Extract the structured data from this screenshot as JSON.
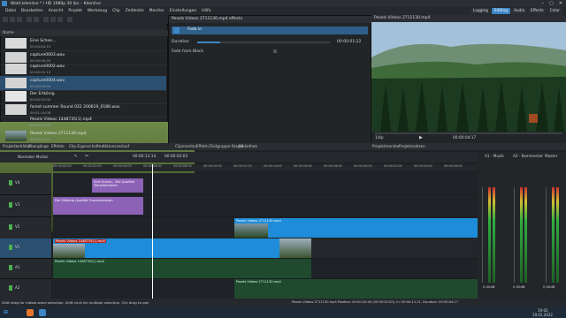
{
  "window": {
    "title": "Wald.kdenlive * / HD 1080p 30 fps – Kdenlive",
    "controls": [
      "–",
      "▢",
      "✕"
    ]
  },
  "menu": [
    "Datei",
    "Bearbeiten",
    "Ansicht",
    "Projekt",
    "Werkzeug",
    "Clip",
    "Zeitleiste",
    "Monitor",
    "Einstellungen",
    "Hilfe"
  ],
  "workspaces": [
    "Logging",
    "Editing",
    "Audio",
    "Effects",
    "Color"
  ],
  "workspace_active": "Editing",
  "bin": {
    "header": "Name",
    "items": [
      {
        "name": "Eine Schee...",
        "duration": "00:00:04:15",
        "kind": "image"
      },
      {
        "name": "capture0003.wav",
        "duration": "00:00:09:20",
        "kind": "wave"
      },
      {
        "name": "capture0002.wav",
        "duration": "00:00:01:12",
        "kind": "wave"
      },
      {
        "name": "capture0004.wav",
        "duration": "00:00:03:09",
        "kind": "wave"
      },
      {
        "name": "Der Erlkönig",
        "duration": "00:00:05:00",
        "kind": "image"
      },
      {
        "name": "forest summer Round 022 200619_0186.wav",
        "duration": "00:01:10:08",
        "kind": "wave"
      },
      {
        "name": "Pexels Videos 1448735(1).mp4",
        "duration": "00:00:12:18",
        "kind": "video"
      },
      {
        "name": "Pexels Videos 2711130.mp4",
        "duration": "00:00:22:01",
        "kind": "video2"
      }
    ],
    "selected_index": 3
  },
  "effects": {
    "title": "Pexels Videos 2711130.mp4 effects",
    "effect_name": "Fade in",
    "duration_label": "Duration",
    "duration_value": "00:00:01:22",
    "fade_from_black": "Fade from Black"
  },
  "monitor": {
    "title": "Pexels Videos 2711130.mp4",
    "timecode": "00:00:04:17",
    "zoom": "1/4p"
  },
  "panel_tabs": {
    "left": [
      "Projektbehälter",
      "Übergänge",
      "Effekte",
      "Clip-Eigenschaften",
      "Aktionsverlauf"
    ],
    "middle": [
      "Clipmonitor",
      "Effekt-/Zeitgruppe-Stapel",
      "Bibliothek"
    ],
    "right": [
      "Projektmonitor",
      "Projektnotizen"
    ]
  },
  "timeline": {
    "mode": "Normaler Modus",
    "timecode": "00:00:11:14",
    "duration": "00:00:02:03",
    "ruler": [
      "00:00:00:00",
      "00:00:02:00",
      "00:00:04:00",
      "00:00:06:00",
      "00:00:08:00",
      "00:00:10:00",
      "00:00:12:00",
      "00:00:14:00",
      "00:00:16:00",
      "00:00:18:00",
      "00:00:20:00",
      "00:00:22:00",
      "00:00:24:00",
      "00:00:26:00"
    ],
    "tracks": [
      "V4",
      "V3",
      "V2",
      "V1",
      "A1",
      "A2"
    ],
    "clips": {
      "v4_clip": "Eine Schee... Mix Qualität Transformieren",
      "v3_clip": "Der Erlkönig Qualität Transformieren",
      "v2_clip": "Pexels Videos 2711130.mp4",
      "v1_clip": "Pexels Videos 1448735(1).mp4",
      "a1_clip": "Pexels Videos 1448735(1).mp4",
      "a2_clip": "Pexels Videos 2711130.mp4"
    }
  },
  "mixer": {
    "channels": [
      "A1 - Musik",
      "A2 - Kommentar",
      "Master"
    ],
    "values": [
      "0,00dB",
      "0,00dB",
      "0,00dB"
    ]
  },
  "status": {
    "hint": "Shift drag for rubber-band selection, Shift click for multiple selection, Ctrl drag to pan",
    "clip_info": "Pexels Videos 2711130.mp4 Position: 00:00:20:00 (00:00:20:20), In: 00:00:11:11, Duration: 00:00:04:17"
  },
  "taskbar": {
    "time": "19:02",
    "date": "19.01.2022"
  },
  "colors": {
    "accent": "#3d86c6",
    "clip_purple": "#8c62b7",
    "clip_blue": "#1e8cd8",
    "clip_green_dark": "#1f4a2e",
    "selected_row": "#2b4f6f"
  }
}
